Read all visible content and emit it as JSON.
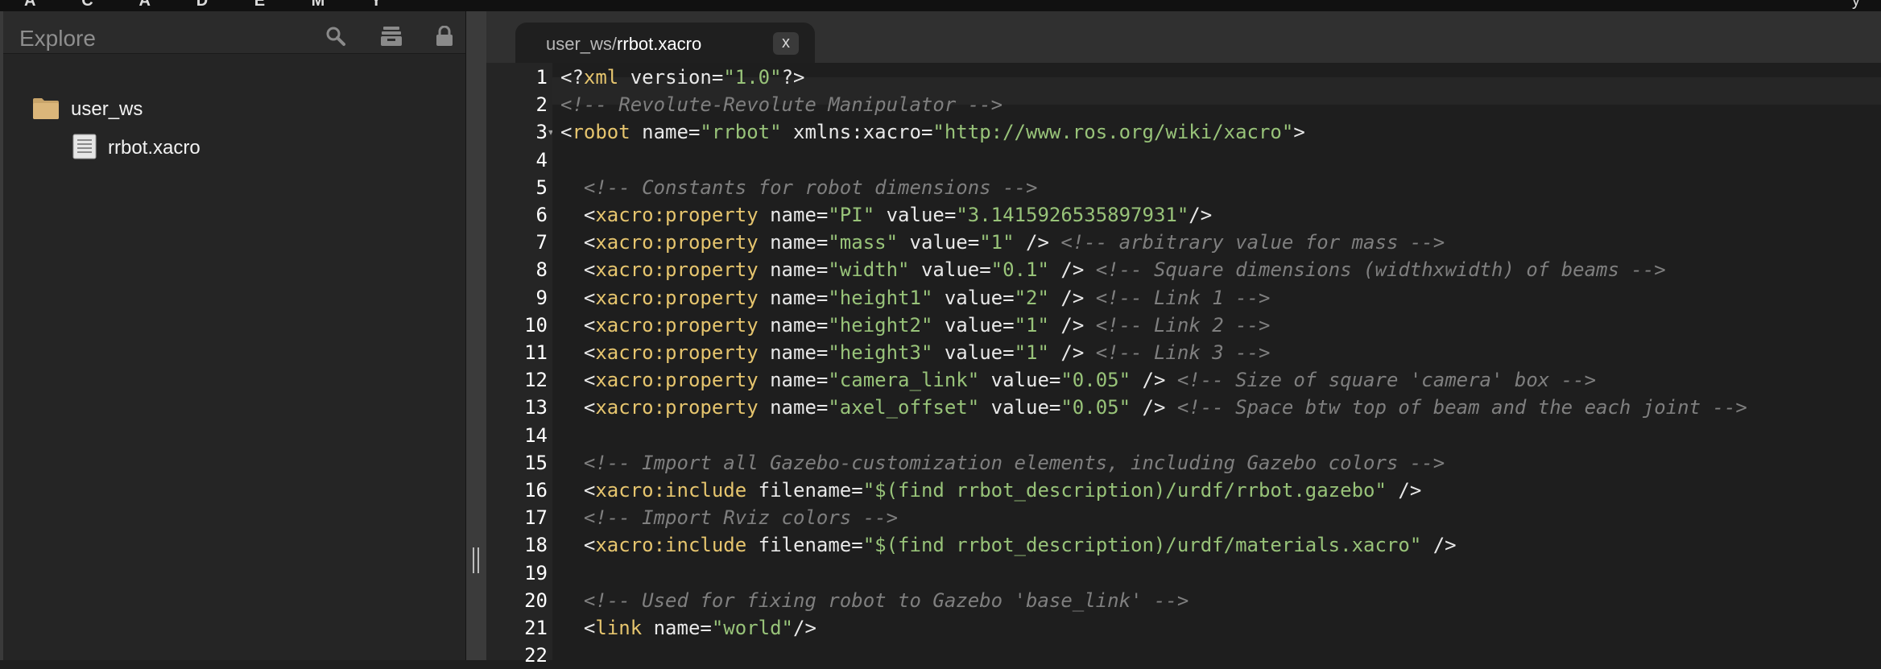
{
  "topbar": {
    "brand": "A C A D E M Y",
    "right_glyph": "y"
  },
  "sidebar": {
    "title": "Explore",
    "tree": [
      {
        "label": "user_ws",
        "type": "folder"
      },
      {
        "label": "rrbot.xacro",
        "type": "file"
      }
    ]
  },
  "tab": {
    "dir": "user_ws/",
    "file": "rrbot.xacro",
    "close": "x"
  },
  "editor": {
    "line_numbers": [
      "1",
      "2",
      "3",
      "4",
      "5",
      "6",
      "7",
      "8",
      "9",
      "10",
      "11",
      "12",
      "13",
      "14",
      "15",
      "16",
      "17",
      "18",
      "19",
      "20",
      "21",
      "22"
    ],
    "lines": [
      [
        [
          "t",
          "<?"
        ],
        [
          "k",
          "xml"
        ],
        [
          "t",
          " version="
        ],
        [
          "s",
          "\"1.0\""
        ],
        [
          "t",
          "?>"
        ]
      ],
      [
        [
          "c",
          "<!-- Revolute-Revolute Manipulator -->"
        ]
      ],
      [
        [
          "t",
          "<"
        ],
        [
          "k",
          "robot"
        ],
        [
          "t",
          " name="
        ],
        [
          "s",
          "\"rrbot\""
        ],
        [
          "t",
          " xmlns:xacro="
        ],
        [
          "s",
          "\"http://www.ros.org/wiki/xacro\""
        ],
        [
          "t",
          ">"
        ]
      ],
      [],
      [
        [
          "t",
          "  "
        ],
        [
          "c",
          "<!-- Constants for robot dimensions -->"
        ]
      ],
      [
        [
          "t",
          "  <"
        ],
        [
          "k",
          "xacro:property"
        ],
        [
          "t",
          " name="
        ],
        [
          "s",
          "\"PI\""
        ],
        [
          "t",
          " value="
        ],
        [
          "s",
          "\"3.1415926535897931\""
        ],
        [
          "t",
          "/>"
        ]
      ],
      [
        [
          "t",
          "  <"
        ],
        [
          "k",
          "xacro:property"
        ],
        [
          "t",
          " name="
        ],
        [
          "s",
          "\"mass\""
        ],
        [
          "t",
          " value="
        ],
        [
          "s",
          "\"1\""
        ],
        [
          "t",
          " /> "
        ],
        [
          "c",
          "<!-- arbitrary value for mass -->"
        ]
      ],
      [
        [
          "t",
          "  <"
        ],
        [
          "k",
          "xacro:property"
        ],
        [
          "t",
          " name="
        ],
        [
          "s",
          "\"width\""
        ],
        [
          "t",
          " value="
        ],
        [
          "s",
          "\"0.1\""
        ],
        [
          "t",
          " /> "
        ],
        [
          "c",
          "<!-- Square dimensions (widthxwidth) of beams -->"
        ]
      ],
      [
        [
          "t",
          "  <"
        ],
        [
          "k",
          "xacro:property"
        ],
        [
          "t",
          " name="
        ],
        [
          "s",
          "\"height1\""
        ],
        [
          "t",
          " value="
        ],
        [
          "s",
          "\"2\""
        ],
        [
          "t",
          " /> "
        ],
        [
          "c",
          "<!-- Link 1 -->"
        ]
      ],
      [
        [
          "t",
          "  <"
        ],
        [
          "k",
          "xacro:property"
        ],
        [
          "t",
          " name="
        ],
        [
          "s",
          "\"height2\""
        ],
        [
          "t",
          " value="
        ],
        [
          "s",
          "\"1\""
        ],
        [
          "t",
          " /> "
        ],
        [
          "c",
          "<!-- Link 2 -->"
        ]
      ],
      [
        [
          "t",
          "  <"
        ],
        [
          "k",
          "xacro:property"
        ],
        [
          "t",
          " name="
        ],
        [
          "s",
          "\"height3\""
        ],
        [
          "t",
          " value="
        ],
        [
          "s",
          "\"1\""
        ],
        [
          "t",
          " /> "
        ],
        [
          "c",
          "<!-- Link 3 -->"
        ]
      ],
      [
        [
          "t",
          "  <"
        ],
        [
          "k",
          "xacro:property"
        ],
        [
          "t",
          " name="
        ],
        [
          "s",
          "\"camera_link\""
        ],
        [
          "t",
          " value="
        ],
        [
          "s",
          "\"0.05\""
        ],
        [
          "t",
          " /> "
        ],
        [
          "c",
          "<!-- Size of square 'camera' box -->"
        ]
      ],
      [
        [
          "t",
          "  <"
        ],
        [
          "k",
          "xacro:property"
        ],
        [
          "t",
          " name="
        ],
        [
          "s",
          "\"axel_offset\""
        ],
        [
          "t",
          " value="
        ],
        [
          "s",
          "\"0.05\""
        ],
        [
          "t",
          " /> "
        ],
        [
          "c",
          "<!-- Space btw top of beam and the each joint -->"
        ]
      ],
      [],
      [
        [
          "t",
          "  "
        ],
        [
          "c",
          "<!-- Import all Gazebo-customization elements, including Gazebo colors -->"
        ]
      ],
      [
        [
          "t",
          "  <"
        ],
        [
          "k",
          "xacro:include"
        ],
        [
          "t",
          " filename="
        ],
        [
          "s",
          "\"$(find rrbot_description)/urdf/rrbot.gazebo\""
        ],
        [
          "t",
          " />"
        ]
      ],
      [
        [
          "t",
          "  "
        ],
        [
          "c",
          "<!-- Import Rviz colors -->"
        ]
      ],
      [
        [
          "t",
          "  <"
        ],
        [
          "k",
          "xacro:include"
        ],
        [
          "t",
          " filename="
        ],
        [
          "s",
          "\"$(find rrbot_description)/urdf/materials.xacro\""
        ],
        [
          "t",
          " />"
        ]
      ],
      [],
      [
        [
          "t",
          "  "
        ],
        [
          "c",
          "<!-- Used for fixing robot to Gazebo 'base_link' -->"
        ]
      ],
      [
        [
          "t",
          "  <"
        ],
        [
          "k",
          "link"
        ],
        [
          "t",
          " name="
        ],
        [
          "s",
          "\"world\""
        ],
        [
          "t",
          "/>"
        ]
      ],
      []
    ]
  }
}
